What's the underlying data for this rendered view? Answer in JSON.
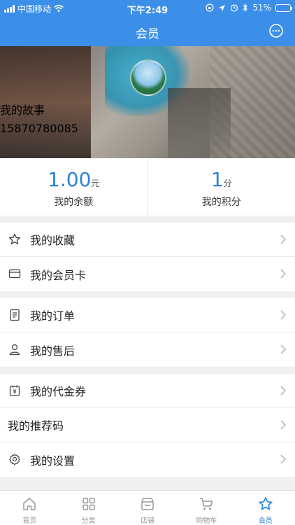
{
  "status_bar": {
    "carrier": "中国移动",
    "time": "下午2:49",
    "battery": "51%"
  },
  "nav": {
    "title": "会员",
    "icon": "chat-bubble-icon"
  },
  "profile": {
    "name": "我的故事",
    "phone": "15870780085"
  },
  "stats": [
    {
      "value": "1.00",
      "unit": "元",
      "label": "我的余额"
    },
    {
      "value": "1",
      "unit": "分",
      "label": "我的积分"
    }
  ],
  "menu": {
    "group1": [
      {
        "label": "我的收藏",
        "icon": "star-icon"
      },
      {
        "label": "我的会员卡",
        "icon": "card-icon"
      }
    ],
    "group2": [
      {
        "label": "我的订单",
        "icon": "order-icon"
      },
      {
        "label": "我的售后",
        "icon": "person-icon"
      }
    ],
    "group3": [
      {
        "label": "我的代金券",
        "icon": "coupon-icon"
      },
      {
        "label": "我的推荐码",
        "icon": ""
      },
      {
        "label": "我的设置",
        "icon": "gear-icon"
      }
    ]
  },
  "tabbar": [
    {
      "label": "首页",
      "icon": "home-icon"
    },
    {
      "label": "分类",
      "icon": "grid-icon"
    },
    {
      "label": "店铺",
      "icon": "store-icon"
    },
    {
      "label": "购物车",
      "icon": "cart-icon"
    },
    {
      "label": "会员",
      "icon": "star-icon",
      "active": true
    }
  ],
  "colors": {
    "primary": "#3b8fe8",
    "accent": "#2b82d9"
  }
}
